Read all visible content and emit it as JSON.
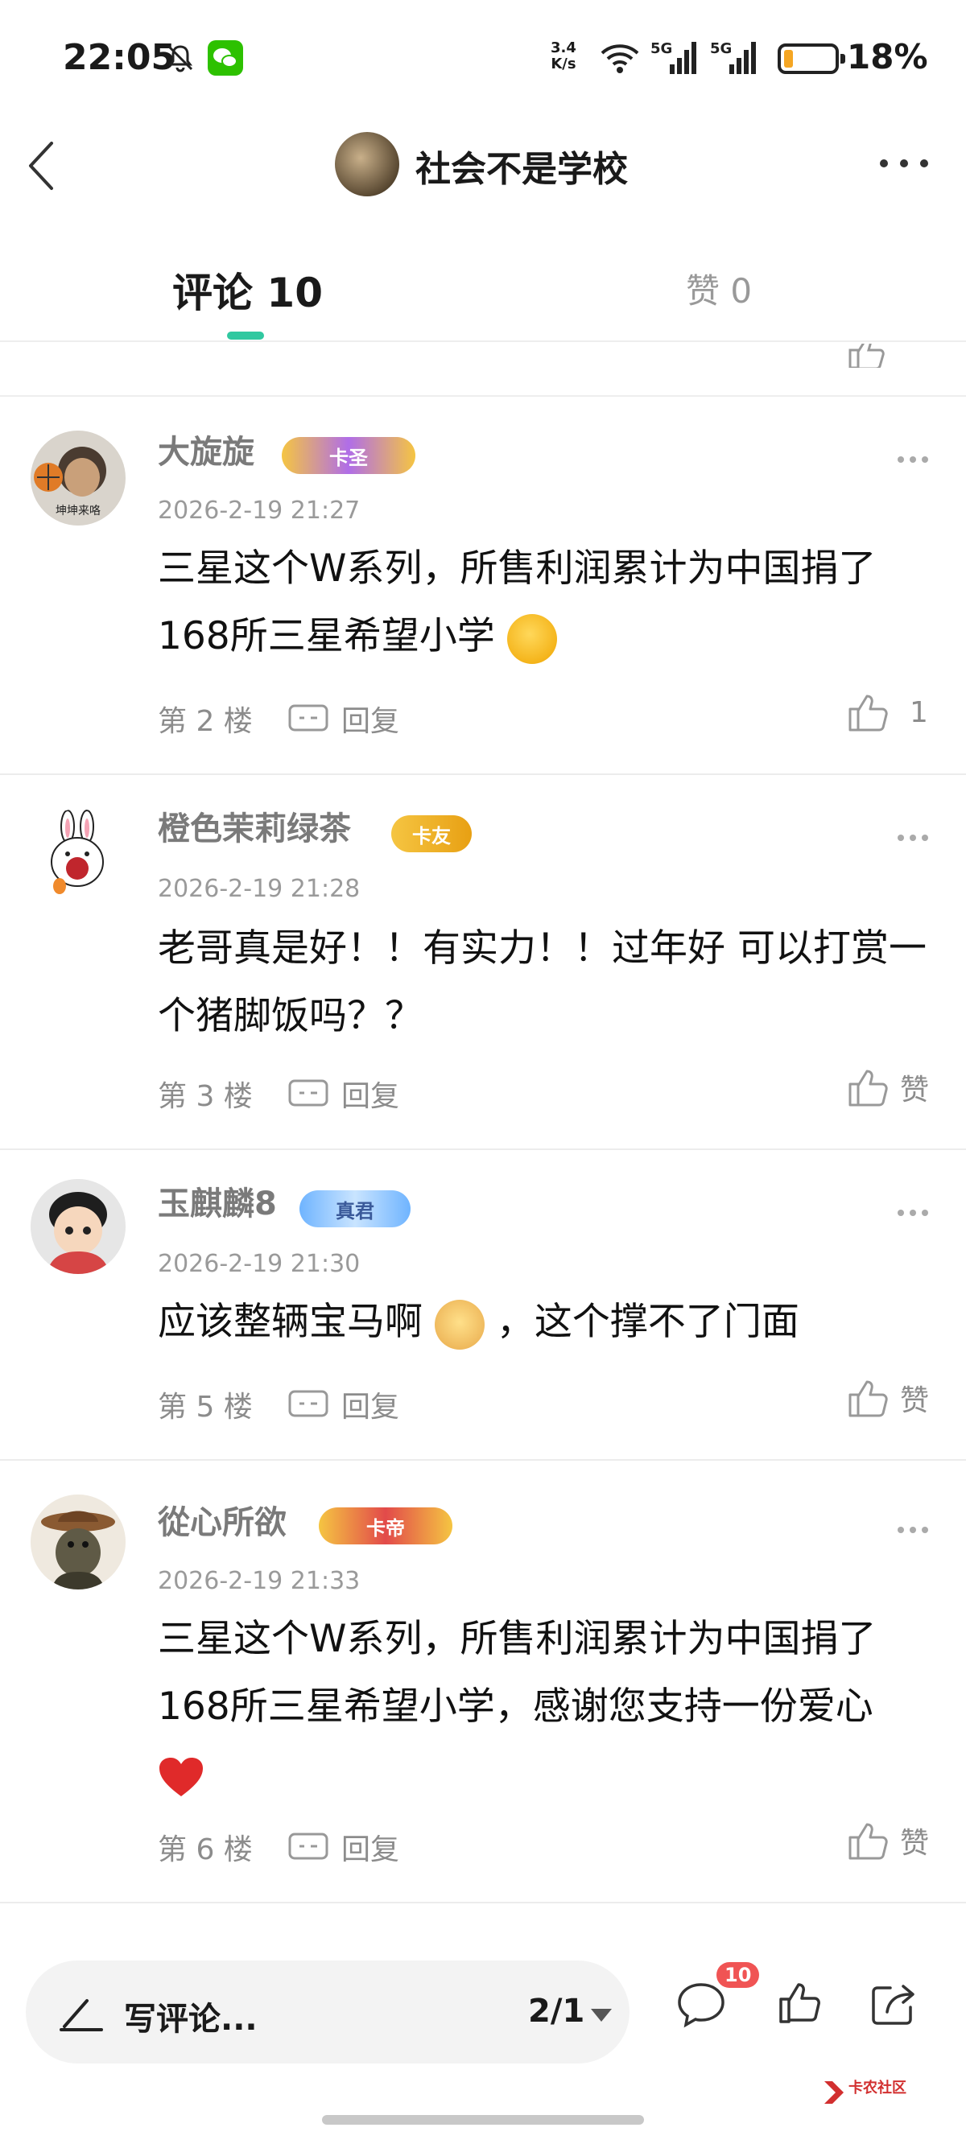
{
  "status_bar": {
    "time": "22:05",
    "net_speed_value": "3.4",
    "net_speed_unit": "K/s",
    "signal_1": "5G",
    "signal_2": "5G",
    "battery_pct": "18%",
    "battery_level": 0.18,
    "battery_color": "#f5a623"
  },
  "header": {
    "title": "社会不是学校",
    "back_icon": "chevron-left-icon",
    "more_icon": "more-horizontal-icon"
  },
  "tabs": [
    {
      "label": "评论 10",
      "active": true
    },
    {
      "label": "赞 0",
      "active": false
    }
  ],
  "accent_color": "#30c8a0",
  "comments": [
    {
      "username": "大旋旋",
      "badge": "卡圣",
      "timestamp": "2026-2-19 21:27",
      "text": "三星这个W系列，所售利润累计为中国捐了168所三星希望小学",
      "emoji": "smiling-face-emoji",
      "floor": "第 2 楼",
      "reply": "回复",
      "like": "1",
      "avatar_text": "坤坤来咯"
    },
    {
      "username": "橙色茉莉绿茶",
      "badge": "卡友",
      "timestamp": "2026-2-19 21:28",
      "text": "老哥真是好！！有实力！！过年好  可以打赏一个猪脚饭吗？？",
      "floor": "第 3 楼",
      "reply": "回复",
      "like": "赞"
    },
    {
      "username": "玉麒麟8",
      "badge": "真君",
      "timestamp": "2026-2-19 21:30",
      "text_before": "应该整辆宝马啊",
      "text_after": "，这个撑不了门面",
      "emoji": "doge-emoji",
      "floor": "第 5 楼",
      "reply": "回复",
      "like": "赞"
    },
    {
      "username": "從心所欲",
      "badge": "卡帝",
      "timestamp": "2026-2-19 21:33",
      "text": "三星这个W系列，所售利润累计为中国捐了168所三星希望小学，感谢您支持一份爱心",
      "emoji": "red-heart-emoji",
      "floor": "第 6 楼",
      "reply": "回复",
      "like": "赞"
    }
  ],
  "bottom_bar": {
    "write_placeholder": "写评论...",
    "page_indicator": "2/1",
    "comment_count": "10",
    "watermark_text": "卡农社区"
  }
}
